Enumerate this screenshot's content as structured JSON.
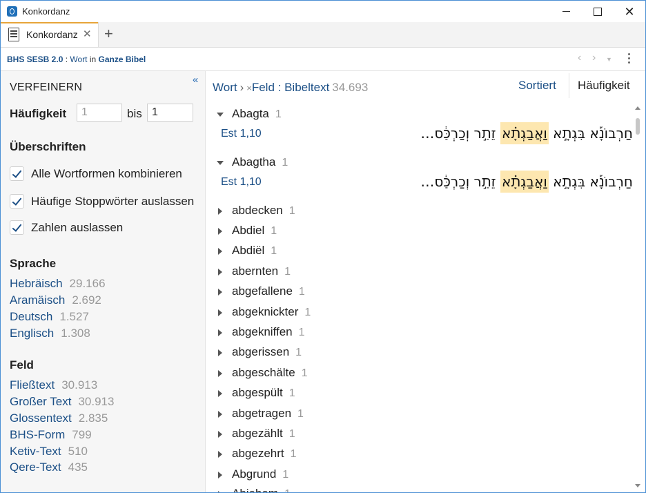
{
  "window": {
    "title": "Konkordanz"
  },
  "tab": {
    "label": "Konkordanz",
    "close": "✕",
    "add": "+"
  },
  "breadcrumb": {
    "resource": "BHS SESB 2.0",
    "sep1": " : ",
    "field": "Wort",
    "in": " in ",
    "scope": "Ganze Bibel"
  },
  "refine": {
    "header": "VERFEINERN",
    "collapse": "«",
    "freq_label": "Häufigkeit",
    "freq_from_placeholder": "1",
    "freq_to": "1",
    "bis": "bis",
    "headings": "Überschriften",
    "options": [
      {
        "label": "Alle Wortformen kombinieren",
        "checked": true
      },
      {
        "label": "Häufige Stoppwörter auslassen",
        "checked": true
      },
      {
        "label": "Zahlen auslassen",
        "checked": true
      }
    ],
    "language_heading": "Sprache",
    "languages": [
      {
        "name": "Hebräisch",
        "count": "29.166"
      },
      {
        "name": "Aramäisch",
        "count": "2.692"
      },
      {
        "name": "Deutsch",
        "count": "1.527"
      },
      {
        "name": "Englisch",
        "count": "1.308"
      }
    ],
    "field_heading": "Feld",
    "fields": [
      {
        "name": "Fließtext",
        "count": "30.913"
      },
      {
        "name": "Großer Text",
        "count": "30.913"
      },
      {
        "name": "Glossentext",
        "count": "2.835"
      },
      {
        "name": "BHS-Form",
        "count": "799"
      },
      {
        "name": "Ketiv-Text",
        "count": "510"
      },
      {
        "name": "Qere-Text",
        "count": "435"
      }
    ]
  },
  "query": {
    "word": "Wort",
    "arrow": "›",
    "remove": "×",
    "field": "Feld : Bibeltext",
    "count": "34.693"
  },
  "controls": {
    "sorted": "Sortiert",
    "frequency": "Häufigkeit"
  },
  "results": [
    {
      "word": "Abagta",
      "count": "1",
      "expanded": true,
      "ref": "Est 1,10",
      "heb_before": "חַרְבוֹנָ֡א בִּגְתָ֣א ",
      "heb_hit": "וַאֲבַגְתָ֗א",
      "heb_after": " זֵתַ֣ר וְכַרְכַּ֔ס…"
    },
    {
      "word": "Abagtha",
      "count": "1",
      "expanded": true,
      "ref": "Est 1,10",
      "heb_before": "חַרְבוֹנָ֡א בִּגְתָ֣א ",
      "heb_hit": "וַאֲבַגְתָ֗א",
      "heb_after": " זֵתַ֣ר וְכַרְכַּ֔ס…"
    },
    {
      "word": "abdecken",
      "count": "1"
    },
    {
      "word": "Abdiel",
      "count": "1"
    },
    {
      "word": "Abdiël",
      "count": "1"
    },
    {
      "word": "abernten",
      "count": "1"
    },
    {
      "word": "abgefallene",
      "count": "1"
    },
    {
      "word": "abgeknickter",
      "count": "1"
    },
    {
      "word": "abgekniffen",
      "count": "1"
    },
    {
      "word": "abgerissen",
      "count": "1"
    },
    {
      "word": "abgeschälte",
      "count": "1"
    },
    {
      "word": "abgespült",
      "count": "1"
    },
    {
      "word": "abgetragen",
      "count": "1"
    },
    {
      "word": "abgezählt",
      "count": "1"
    },
    {
      "word": "abgezehrt",
      "count": "1"
    },
    {
      "word": "Abgrund",
      "count": "1"
    },
    {
      "word": "Abiabam",
      "count": "1"
    }
  ]
}
